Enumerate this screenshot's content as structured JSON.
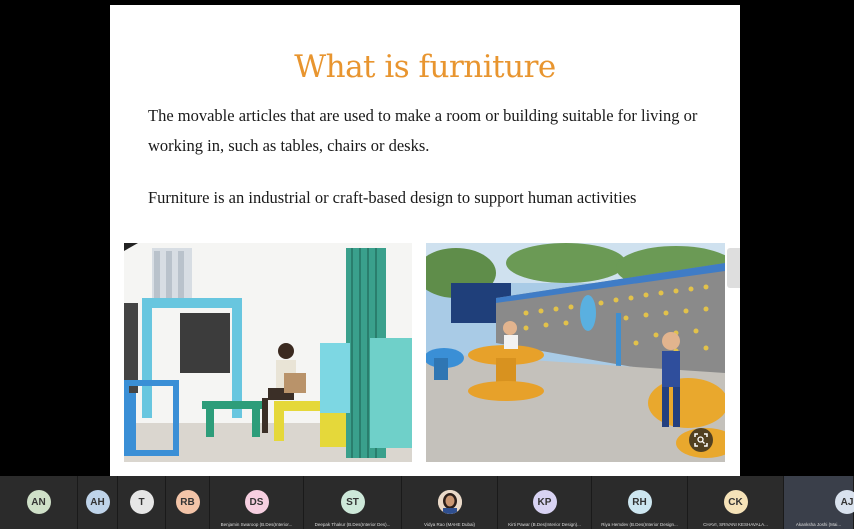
{
  "slide": {
    "title": "What is furniture",
    "paragraph1_line1": "The movable articles that are used to make a room or building suitable for living or",
    "paragraph1_line2": "working in, such as tables, chairs or desks.",
    "paragraph2": "Furniture is an industrial or craft-based design to support human activities",
    "title_color": "#e8952f",
    "image_left": "outdoor-modular-bench-photo",
    "image_right": "playground-spinning-seats-photo"
  },
  "participants": [
    {
      "initials": "AN",
      "name": "",
      "color": "#cfe0c8"
    },
    {
      "initials": "AH",
      "name": "",
      "color": "#bfd4ea"
    },
    {
      "initials": "T",
      "name": "",
      "color": "#e6e6e6"
    },
    {
      "initials": "RB",
      "name": "",
      "color": "#f3c4a8"
    },
    {
      "initials": "DS",
      "name": "Benjamin Swaroop (B.Des(Interior...",
      "color": "#f6cfe0"
    },
    {
      "initials": "ST",
      "name": "Deepak Thakur (B.Des(Interior Des)...",
      "color": "#cde8d9"
    },
    {
      "initials": "",
      "name": "Vidya Rao (MAHE Dubai)",
      "color": "#ead9c8",
      "photo": true
    },
    {
      "initials": "KP",
      "name": "Kirti Pawar (B.Des(Interior Design)...",
      "color": "#d8d3f3"
    },
    {
      "initials": "RH",
      "name": "Riya Hemdev (B.Des(Interior Design...",
      "color": "#cde6f0"
    },
    {
      "initials": "CK",
      "name": "CHAVI, SRIVANI KESHAVALA...",
      "color": "#f5e2b8"
    },
    {
      "initials": "AJ",
      "name": "Akanksha Joshi (Mai...",
      "color": "#d9e2ee"
    }
  ]
}
